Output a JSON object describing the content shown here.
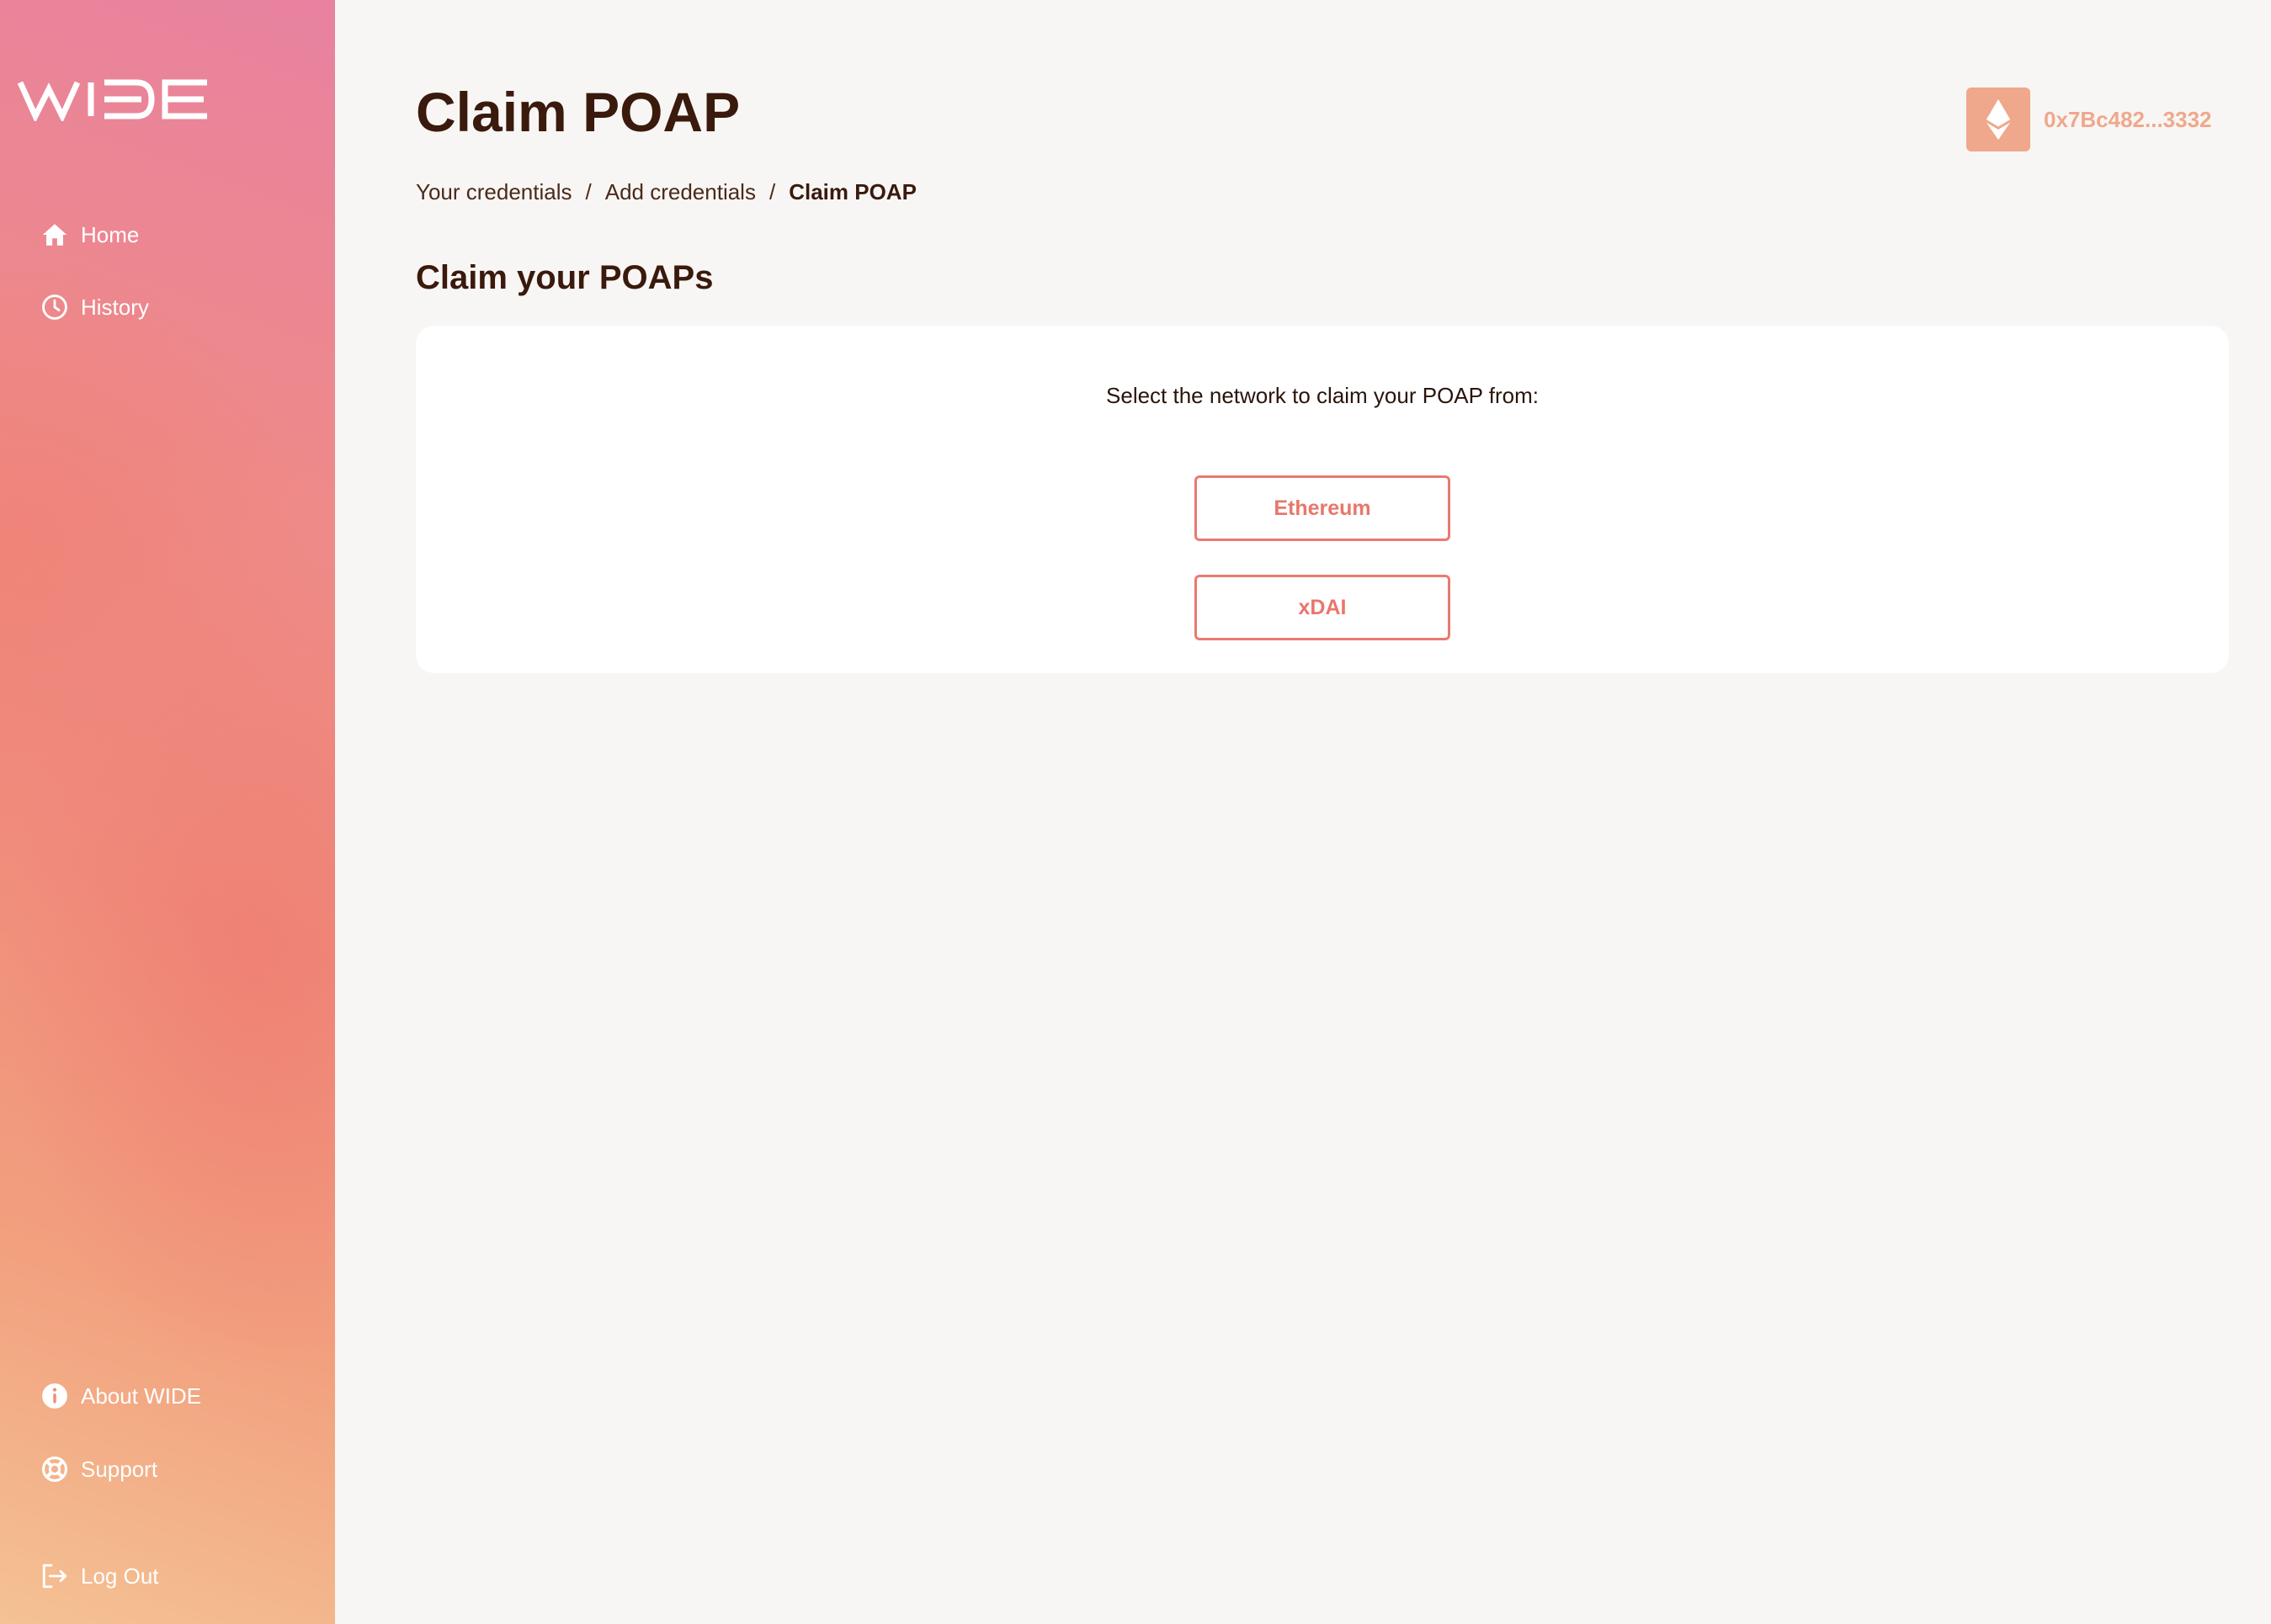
{
  "sidebar": {
    "logo": "WIDE",
    "nav_top": [
      {
        "label": "Home",
        "icon": "home-icon"
      },
      {
        "label": "History",
        "icon": "clock-icon"
      }
    ],
    "nav_bottom": [
      {
        "label": "About WIDE",
        "icon": "info-icon"
      },
      {
        "label": "Support",
        "icon": "lifebuoy-icon"
      },
      {
        "label": "Log Out",
        "icon": "logout-icon"
      }
    ]
  },
  "header": {
    "title": "Claim POAP",
    "breadcrumb": [
      {
        "label": "Your credentials"
      },
      {
        "label": "Add credentials"
      },
      {
        "label": "Claim POAP"
      }
    ],
    "breadcrumb_separator": "/",
    "wallet": {
      "address": "0x7Bc482...3332",
      "icon": "ethereum-icon"
    }
  },
  "main": {
    "section_title": "Claim your POAPs",
    "prompt": "Select the network to claim your POAP from:",
    "networks": [
      {
        "label": "Ethereum"
      },
      {
        "label": "xDAI"
      }
    ]
  },
  "colors": {
    "accent": "#ea7a70",
    "wallet": "#efa88c",
    "text": "#3a1a0c",
    "background": "#f8f6f4"
  }
}
